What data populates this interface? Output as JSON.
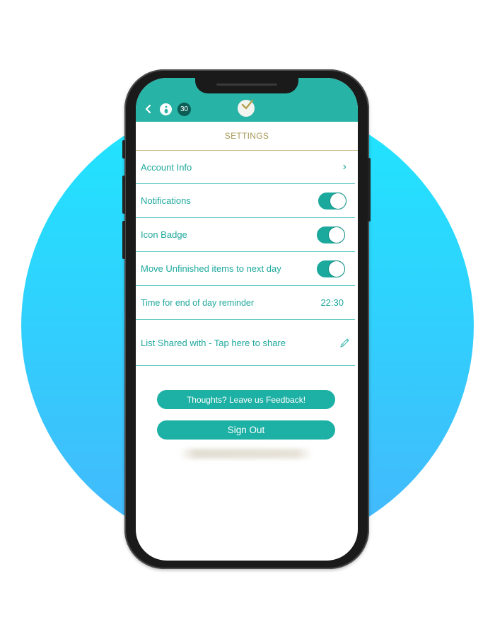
{
  "colors": {
    "accent": "#1fa99d",
    "topbar": "#27b3a5",
    "badge_dark": "#0b5d55",
    "title_gold": "#a89a5a",
    "background_circle_top": "#1fe6fe",
    "background_circle_bottom": "#45b6fb"
  },
  "header": {
    "back_icon": "chevron-left-icon",
    "info_icon": "info-icon",
    "count_badge": "30",
    "logo_icon": "checkmark-clock-logo"
  },
  "settings": {
    "title": "SETTINGS",
    "rows": [
      {
        "label": "Account Info",
        "type": "link",
        "trail_icon": "chevron-right-icon",
        "trail": "›"
      },
      {
        "label": "Notifications",
        "type": "toggle",
        "on": true
      },
      {
        "label": "Icon Badge",
        "type": "toggle",
        "on": true
      },
      {
        "label": "Move Unfinished items to next day",
        "type": "toggle",
        "on": true
      },
      {
        "label": "Time for end of day reminder",
        "type": "value",
        "value": "22:30"
      },
      {
        "label": "List Shared with - Tap here to share",
        "type": "edit",
        "trail_icon": "pencil-icon"
      }
    ]
  },
  "buttons": {
    "feedback": "Thoughts? Leave us Feedback!",
    "sign_out": "Sign Out"
  }
}
